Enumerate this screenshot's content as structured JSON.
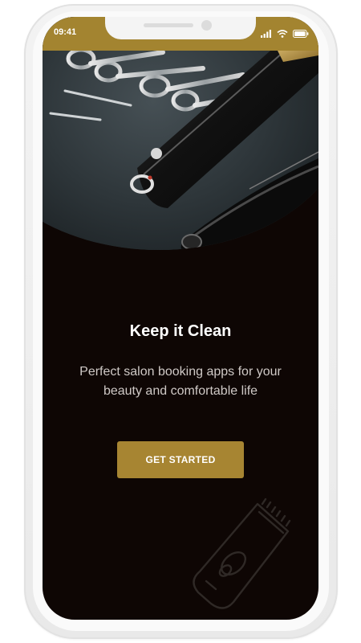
{
  "status_bar": {
    "time": "09:41",
    "background_color": "#a38430",
    "icons": [
      "signal-icon",
      "wifi-icon",
      "battery-icon"
    ]
  },
  "hero": {
    "image_subject": "barber scissors and hair clipper on dark textured mat"
  },
  "onboarding": {
    "title": "Keep it Clean",
    "subtitle": "Perfect salon booking apps for your beauty and comfortable life",
    "cta_label": "GET STARTED"
  },
  "decoration": {
    "icon": "hair-clipper-icon"
  },
  "colors": {
    "accent": "#a78532",
    "screen_background": "#0e0604",
    "title_text": "#ffffff",
    "subtitle_text": "#cfc9c6"
  }
}
